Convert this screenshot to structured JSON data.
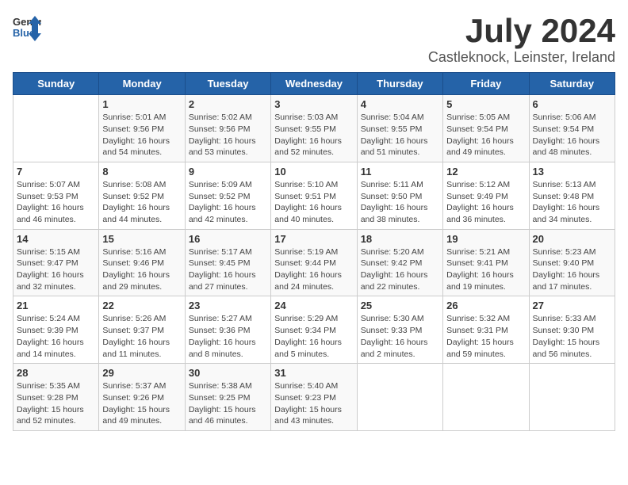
{
  "logo": {
    "line1": "General",
    "line2": "Blue"
  },
  "title": "July 2024",
  "subtitle": "Castleknock, Leinster, Ireland",
  "days_header": [
    "Sunday",
    "Monday",
    "Tuesday",
    "Wednesday",
    "Thursday",
    "Friday",
    "Saturday"
  ],
  "weeks": [
    [
      {
        "num": "",
        "info": ""
      },
      {
        "num": "1",
        "info": "Sunrise: 5:01 AM\nSunset: 9:56 PM\nDaylight: 16 hours\nand 54 minutes."
      },
      {
        "num": "2",
        "info": "Sunrise: 5:02 AM\nSunset: 9:56 PM\nDaylight: 16 hours\nand 53 minutes."
      },
      {
        "num": "3",
        "info": "Sunrise: 5:03 AM\nSunset: 9:55 PM\nDaylight: 16 hours\nand 52 minutes."
      },
      {
        "num": "4",
        "info": "Sunrise: 5:04 AM\nSunset: 9:55 PM\nDaylight: 16 hours\nand 51 minutes."
      },
      {
        "num": "5",
        "info": "Sunrise: 5:05 AM\nSunset: 9:54 PM\nDaylight: 16 hours\nand 49 minutes."
      },
      {
        "num": "6",
        "info": "Sunrise: 5:06 AM\nSunset: 9:54 PM\nDaylight: 16 hours\nand 48 minutes."
      }
    ],
    [
      {
        "num": "7",
        "info": "Sunrise: 5:07 AM\nSunset: 9:53 PM\nDaylight: 16 hours\nand 46 minutes."
      },
      {
        "num": "8",
        "info": "Sunrise: 5:08 AM\nSunset: 9:52 PM\nDaylight: 16 hours\nand 44 minutes."
      },
      {
        "num": "9",
        "info": "Sunrise: 5:09 AM\nSunset: 9:52 PM\nDaylight: 16 hours\nand 42 minutes."
      },
      {
        "num": "10",
        "info": "Sunrise: 5:10 AM\nSunset: 9:51 PM\nDaylight: 16 hours\nand 40 minutes."
      },
      {
        "num": "11",
        "info": "Sunrise: 5:11 AM\nSunset: 9:50 PM\nDaylight: 16 hours\nand 38 minutes."
      },
      {
        "num": "12",
        "info": "Sunrise: 5:12 AM\nSunset: 9:49 PM\nDaylight: 16 hours\nand 36 minutes."
      },
      {
        "num": "13",
        "info": "Sunrise: 5:13 AM\nSunset: 9:48 PM\nDaylight: 16 hours\nand 34 minutes."
      }
    ],
    [
      {
        "num": "14",
        "info": "Sunrise: 5:15 AM\nSunset: 9:47 PM\nDaylight: 16 hours\nand 32 minutes."
      },
      {
        "num": "15",
        "info": "Sunrise: 5:16 AM\nSunset: 9:46 PM\nDaylight: 16 hours\nand 29 minutes."
      },
      {
        "num": "16",
        "info": "Sunrise: 5:17 AM\nSunset: 9:45 PM\nDaylight: 16 hours\nand 27 minutes."
      },
      {
        "num": "17",
        "info": "Sunrise: 5:19 AM\nSunset: 9:44 PM\nDaylight: 16 hours\nand 24 minutes."
      },
      {
        "num": "18",
        "info": "Sunrise: 5:20 AM\nSunset: 9:42 PM\nDaylight: 16 hours\nand 22 minutes."
      },
      {
        "num": "19",
        "info": "Sunrise: 5:21 AM\nSunset: 9:41 PM\nDaylight: 16 hours\nand 19 minutes."
      },
      {
        "num": "20",
        "info": "Sunrise: 5:23 AM\nSunset: 9:40 PM\nDaylight: 16 hours\nand 17 minutes."
      }
    ],
    [
      {
        "num": "21",
        "info": "Sunrise: 5:24 AM\nSunset: 9:39 PM\nDaylight: 16 hours\nand 14 minutes."
      },
      {
        "num": "22",
        "info": "Sunrise: 5:26 AM\nSunset: 9:37 PM\nDaylight: 16 hours\nand 11 minutes."
      },
      {
        "num": "23",
        "info": "Sunrise: 5:27 AM\nSunset: 9:36 PM\nDaylight: 16 hours\nand 8 minutes."
      },
      {
        "num": "24",
        "info": "Sunrise: 5:29 AM\nSunset: 9:34 PM\nDaylight: 16 hours\nand 5 minutes."
      },
      {
        "num": "25",
        "info": "Sunrise: 5:30 AM\nSunset: 9:33 PM\nDaylight: 16 hours\nand 2 minutes."
      },
      {
        "num": "26",
        "info": "Sunrise: 5:32 AM\nSunset: 9:31 PM\nDaylight: 15 hours\nand 59 minutes."
      },
      {
        "num": "27",
        "info": "Sunrise: 5:33 AM\nSunset: 9:30 PM\nDaylight: 15 hours\nand 56 minutes."
      }
    ],
    [
      {
        "num": "28",
        "info": "Sunrise: 5:35 AM\nSunset: 9:28 PM\nDaylight: 15 hours\nand 52 minutes."
      },
      {
        "num": "29",
        "info": "Sunrise: 5:37 AM\nSunset: 9:26 PM\nDaylight: 15 hours\nand 49 minutes."
      },
      {
        "num": "30",
        "info": "Sunrise: 5:38 AM\nSunset: 9:25 PM\nDaylight: 15 hours\nand 46 minutes."
      },
      {
        "num": "31",
        "info": "Sunrise: 5:40 AM\nSunset: 9:23 PM\nDaylight: 15 hours\nand 43 minutes."
      },
      {
        "num": "",
        "info": ""
      },
      {
        "num": "",
        "info": ""
      },
      {
        "num": "",
        "info": ""
      }
    ]
  ]
}
